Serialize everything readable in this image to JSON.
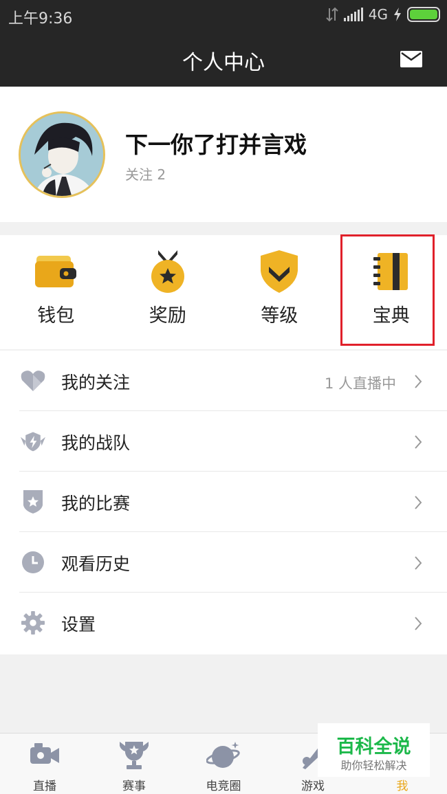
{
  "status_bar": {
    "time": "上午9:36",
    "network": "4G"
  },
  "header": {
    "title": "个人中心",
    "mail_icon": "mail-icon"
  },
  "profile": {
    "nickname": "下一你了打并言戏",
    "follow": "关注 2"
  },
  "tiles": [
    {
      "label": "钱包",
      "icon": "wallet-icon"
    },
    {
      "label": "奖励",
      "icon": "medal-icon"
    },
    {
      "label": "等级",
      "icon": "shield-chevron-icon"
    },
    {
      "label": "宝典",
      "icon": "notebook-icon"
    }
  ],
  "menu": [
    {
      "label": "我的关注",
      "extra": "1 人直播中",
      "icon": "heart-tag-icon"
    },
    {
      "label": "我的战队",
      "extra": "",
      "icon": "team-shield-icon"
    },
    {
      "label": "我的比赛",
      "extra": "",
      "icon": "star-badge-icon"
    },
    {
      "label": "观看历史",
      "extra": "",
      "icon": "clock-icon"
    },
    {
      "label": "设置",
      "extra": "",
      "icon": "gear-icon"
    }
  ],
  "bottom_nav": [
    {
      "label": "直播",
      "icon": "video-camera-icon"
    },
    {
      "label": "赛事",
      "icon": "trophy-icon"
    },
    {
      "label": "电竞圈",
      "icon": "planet-icon"
    },
    {
      "label": "游戏",
      "icon": "game-icon"
    },
    {
      "label": "我",
      "icon": "me-icon",
      "active": true
    }
  ],
  "watermark": {
    "title": "百科全说",
    "subtitle": "助你轻松解决"
  },
  "colors": {
    "accent": "#e9a71a",
    "highlight_box": "#e0202a",
    "header_bg": "#262626",
    "battery": "#5dd13b"
  }
}
